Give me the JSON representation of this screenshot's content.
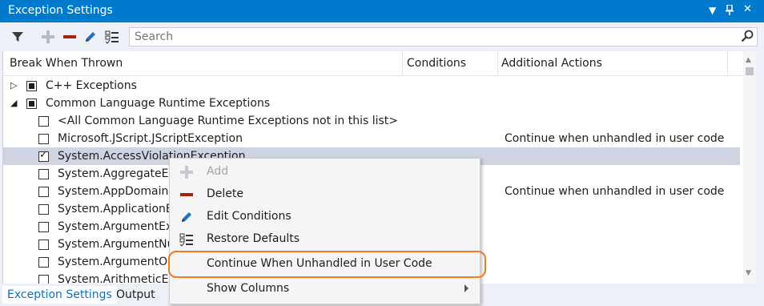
{
  "window": {
    "title": "Exception Settings"
  },
  "search": {
    "placeholder": "Search"
  },
  "columns": {
    "break": "Break When Thrown",
    "conditions": "Conditions",
    "actions": "Additional Actions"
  },
  "rows": [
    {
      "label": "C++ Exceptions"
    },
    {
      "label": "Common Language Runtime Exceptions"
    },
    {
      "label": "<All Common Language Runtime Exceptions not in this list>",
      "action": ""
    },
    {
      "label": "Microsoft.JScript.JScriptException",
      "action": "Continue when unhandled in user code"
    },
    {
      "label": "System.AccessViolationException",
      "action": ""
    },
    {
      "label": "System.AggregateExc",
      "action": ""
    },
    {
      "label": "System.AppDomainU",
      "action": "Continue when unhandled in user code"
    },
    {
      "label": "System.ApplicationEx",
      "action": ""
    },
    {
      "label": "System.ArgumentExce",
      "action": ""
    },
    {
      "label": "System.ArgumentNull",
      "action": ""
    },
    {
      "label": "System.ArgumentOut",
      "action": ""
    },
    {
      "label": "System.ArithmeticE",
      "action": ""
    }
  ],
  "menu": {
    "items": [
      {
        "label": "Add"
      },
      {
        "label": "Delete"
      },
      {
        "label": "Edit Conditions"
      },
      {
        "label": "Restore Defaults"
      },
      {
        "label": "Continue When Unhandled in User Code"
      },
      {
        "label": "Show Columns"
      }
    ]
  },
  "tabs": [
    {
      "label": "Exception Settings"
    },
    {
      "label": "Output"
    }
  ],
  "colors": {
    "titlebar": "#007acc",
    "highlight": "#f07b26",
    "selection": "#cfd3e2"
  }
}
